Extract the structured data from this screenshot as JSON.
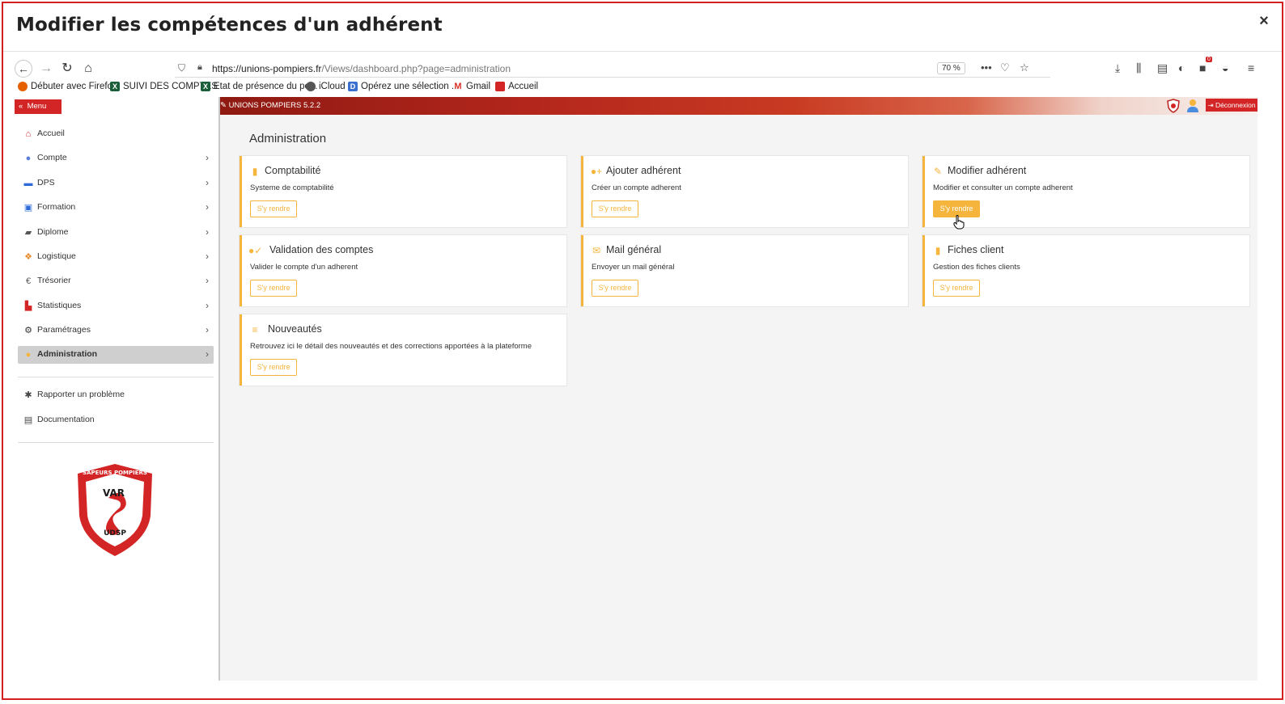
{
  "modal": {
    "title": "Modifier les compétences d'un adhérent",
    "close": "×"
  },
  "browser": {
    "url_host": "https://unions-pompiers.fr",
    "url_path": "/Views/dashboard.php?page=administration",
    "zoom": "70 %",
    "bookmarks": [
      {
        "label": "Débuter avec Firefox",
        "icon": "firefox-icon"
      },
      {
        "label": "SUIVI DES COMPTES",
        "icon": "excel-icon"
      },
      {
        "label": "Etat de présence du pe...",
        "icon": "excel-icon"
      },
      {
        "label": "iCloud",
        "icon": "apple-icon"
      },
      {
        "label": "Opérez une sélection ...",
        "icon": "page-icon"
      },
      {
        "label": "Gmail",
        "icon": "gmail-icon"
      },
      {
        "label": "Accueil",
        "icon": "app-icon"
      }
    ],
    "notification_badge": "0"
  },
  "app": {
    "menu_label": "Menu",
    "brand": "UNIONS POMPIERS 5.2.2",
    "logout_label": "Déconnexion",
    "page_title": "Administration",
    "sidebar": [
      {
        "label": "Accueil",
        "icon": "home-icon",
        "chevron": false
      },
      {
        "label": "Compte",
        "icon": "user-icon",
        "chevron": true
      },
      {
        "label": "DPS",
        "icon": "ambulance-icon",
        "chevron": true
      },
      {
        "label": "Formation",
        "icon": "training-icon",
        "chevron": true
      },
      {
        "label": "Diplome",
        "icon": "graduation-cap-icon",
        "chevron": true
      },
      {
        "label": "Logistique",
        "icon": "cubes-icon",
        "chevron": true
      },
      {
        "label": "Trésorier",
        "icon": "euro-icon",
        "chevron": true
      },
      {
        "label": "Statistiques",
        "icon": "chart-icon",
        "chevron": true
      },
      {
        "label": "Paramétrages",
        "icon": "cogs-icon",
        "chevron": true
      },
      {
        "label": "Administration",
        "icon": "users-cog-icon",
        "chevron": true,
        "active": true
      }
    ],
    "sidebar_footer": [
      {
        "label": "Rapporter un problème",
        "icon": "bug-icon"
      },
      {
        "label": "Documentation",
        "icon": "book-icon"
      }
    ],
    "logo_text": {
      "top": "SAPEURS POMPIERS",
      "middle": "VAR",
      "bottom": "UDSP"
    },
    "cards": [
      {
        "title": "Comptabilité",
        "desc": "Systeme de comptabilité",
        "button": "S'y rendre",
        "icon": "file-invoice-icon"
      },
      {
        "title": "Ajouter adhérent",
        "desc": "Créer un compte adherent",
        "button": "S'y rendre",
        "icon": "user-plus-icon"
      },
      {
        "title": "Modifier adhérent",
        "desc": "Modifier et consulter un compte adherent",
        "button": "S'y rendre",
        "icon": "edit-icon",
        "hover": true
      },
      {
        "title": "Validation des comptes",
        "desc": "Valider le compte d'un adherent",
        "button": "S'y rendre",
        "icon": "user-check-icon"
      },
      {
        "title": "Mail général",
        "desc": "Envoyer un mail général",
        "button": "S'y rendre",
        "icon": "envelope-icon"
      },
      {
        "title": "Fiches client",
        "desc": "Gestion des fiches clients",
        "button": "S'y rendre",
        "icon": "address-card-icon"
      },
      {
        "title": "Nouveautés",
        "desc": "Retrouvez ici le détail des nouveautés et des corrections apportées à la plateforme",
        "button": "S'y rendre",
        "icon": "list-icon"
      }
    ],
    "colors": {
      "accent": "#f5b43c",
      "brand_red": "#d32525",
      "active_bg": "#cfcfcf"
    }
  }
}
